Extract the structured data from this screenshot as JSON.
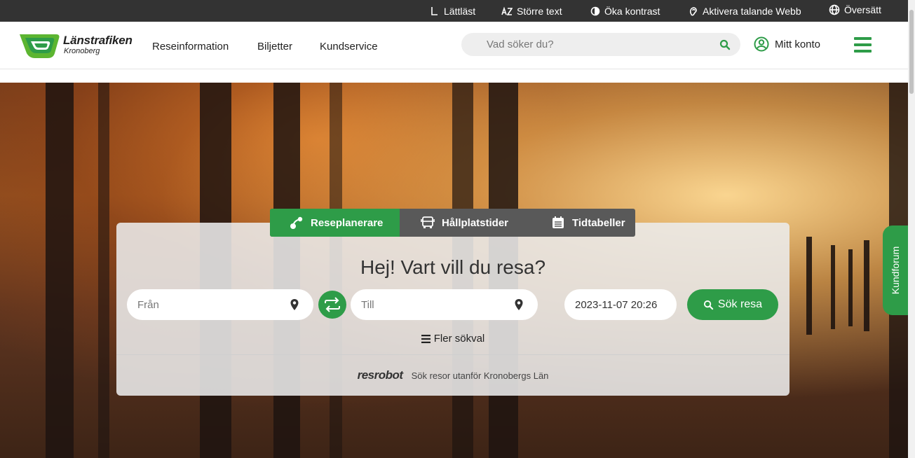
{
  "topbar": {
    "easy_read": "Lättläst",
    "larger_text": "Större text",
    "contrast": "Öka kontrast",
    "talking_web": "Aktivera talande Webb",
    "translate": "Översätt"
  },
  "header": {
    "logo_line1": "Länstrafiken",
    "logo_line2": "Kronoberg",
    "nav": [
      "Reseinformation",
      "Biljetter",
      "Kundservice"
    ],
    "search_placeholder": "Vad söker du?",
    "account_label": "Mitt konto"
  },
  "planner": {
    "tabs": [
      "Reseplanerare",
      "Hållplatstider",
      "Tidtabeller"
    ],
    "active_tab": 0,
    "heading": "Hej! Vart vill du resa?",
    "from_placeholder": "Från",
    "to_placeholder": "Till",
    "datetime_value": "2023-11-07 20:26",
    "search_button": "Sök resa",
    "more_options": "Fler sökval",
    "resrobot_logo": "resrobot",
    "resrobot_text": "Sök resor utanför Kronobergs Län"
  },
  "side_tab": {
    "label": "Kundforum"
  },
  "colors": {
    "brand_green": "#2e9c48",
    "topbar": "#333333",
    "tab_gray": "#595959"
  }
}
